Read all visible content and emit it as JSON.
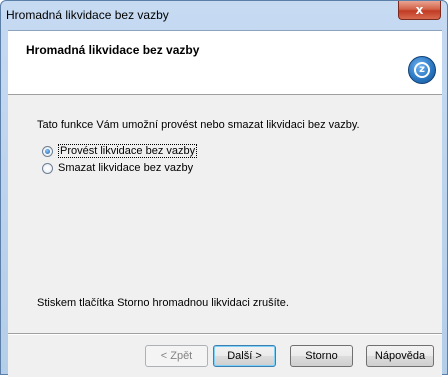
{
  "window": {
    "title": "Hromadná likvidace bez vazby",
    "close_label": "x"
  },
  "header": {
    "title": "Hromadná likvidace bez vazby",
    "logo_icon": "app-logo-icon"
  },
  "content": {
    "description": "Tato funkce Vám umožní provést nebo smazat likvidaci bez vazby.",
    "options": [
      {
        "label": "Provést likvidace bez vazby",
        "selected": true
      },
      {
        "label": "Smazat likvidace bez vazby",
        "selected": false
      }
    ],
    "footer_note": "Stiskem tlačítka Storno hromadnou likvidaci zrušíte."
  },
  "buttons": {
    "back": "< Zpět",
    "next": "Další >",
    "cancel": "Storno",
    "help": "Nápověda"
  },
  "colors": {
    "accent": "#2b78c4",
    "close": "#c13b24"
  }
}
